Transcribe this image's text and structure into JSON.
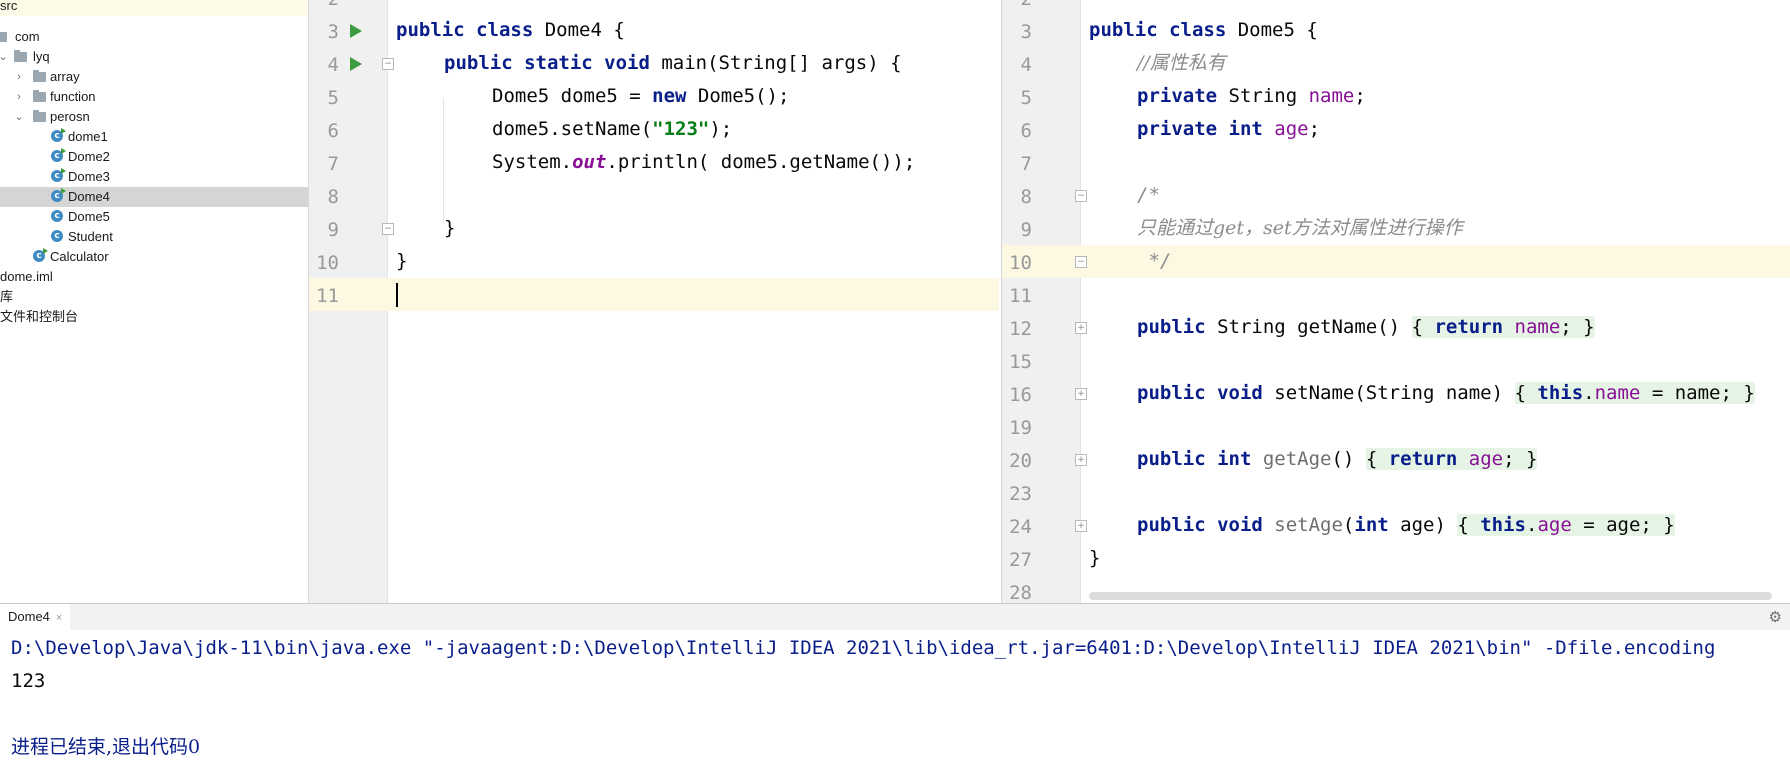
{
  "project_tree": {
    "items": [
      {
        "label": "src",
        "kind": "folder"
      },
      {
        "label": "com",
        "kind": "folder"
      },
      {
        "label": "lyq",
        "kind": "folder"
      },
      {
        "label": "array",
        "kind": "folder"
      },
      {
        "label": "function",
        "kind": "folder"
      },
      {
        "label": "perosn",
        "kind": "folder"
      },
      {
        "label": "dome1",
        "kind": "class-run"
      },
      {
        "label": "Dome2",
        "kind": "class-run"
      },
      {
        "label": "Dome3",
        "kind": "class-run"
      },
      {
        "label": "Dome4",
        "kind": "class-run",
        "selected": true
      },
      {
        "label": "Dome5",
        "kind": "class"
      },
      {
        "label": "Student",
        "kind": "class"
      },
      {
        "label": "Calculator",
        "kind": "class-run"
      },
      {
        "label": "dome.iml",
        "kind": "file"
      },
      {
        "label": "库",
        "kind": "library"
      },
      {
        "label": "文件和控制台",
        "kind": "scratch"
      }
    ]
  },
  "editor_left": {
    "file": "Dome4",
    "line_numbers": [
      "2",
      "3",
      "4",
      "5",
      "6",
      "7",
      "8",
      "9",
      "10",
      "11"
    ],
    "lines": {
      "l3_kw": "public class ",
      "l3_rest": "Dome4 {",
      "l4_kw": "public static void ",
      "l4_rest": "main(String[] args) {",
      "l5_a": "Dome5 dome5 = ",
      "l5_kw": "new ",
      "l5_b": "Dome5();",
      "l6_a": "dome5.setName(",
      "l6_str": "\"123\"",
      "l6_b": ");",
      "l7_a": "System.",
      "l7_field": "out",
      "l7_b": ".println( dome5.getName());",
      "l9": "}",
      "l10": "}"
    }
  },
  "editor_right": {
    "file": "Dome5",
    "line_numbers": [
      "2",
      "3",
      "4",
      "5",
      "6",
      "7",
      "8",
      "9",
      "10",
      "11",
      "12",
      "15",
      "16",
      "19",
      "20",
      "23",
      "24",
      "27",
      "28"
    ],
    "lines": {
      "l3_kw": "public class ",
      "l3_rest": "Dome5 {",
      "l4_comment": "//属性私有",
      "l5_kw": "private ",
      "l5_type": "String ",
      "l5_field": "name",
      "l5_end": ";",
      "l6_kw": "private int ",
      "l6_field": "age",
      "l6_end": ";",
      "l8_comment": "/*",
      "l9_comment": "只能通过get，set方法对属性进行操作",
      "l10_comment": " */",
      "l12_kw": "public ",
      "l12_a": "String getName() ",
      "l12_fold_kw": "return ",
      "l12_fold_field": "name",
      "l12_fold_end": "; ",
      "l16_kw": "public void ",
      "l16_a": "setName(String name) ",
      "l16_this": "this",
      "l16_dot": ".",
      "l16_field": "name",
      "l16_b": " = name; ",
      "l20_kw": "public int ",
      "l20_method": "getAge",
      "l20_a": "() ",
      "l20_ret": "return ",
      "l20_field": "age",
      "l20_end": "; ",
      "l24_kw": "public void ",
      "l24_method": "setAge",
      "l24_a": "(",
      "l24_int": "int ",
      "l24_b": "age) ",
      "l24_this": "this",
      "l24_dot": ".",
      "l24_field": "age",
      "l24_c": " = age; ",
      "l27": "}",
      "open_brace": "{ ",
      "close_brace": "}"
    }
  },
  "run_window": {
    "tab_label": "Dome4",
    "tab_close": "×",
    "settings_icon": "⚙",
    "console": {
      "command": "D:\\Develop\\Java\\jdk-11\\bin\\java.exe \"-javaagent:D:\\Develop\\IntelliJ IDEA 2021\\lib\\idea_rt.jar=6401:D:\\Develop\\IntelliJ IDEA 2021\\bin\" -Dfile.encoding",
      "output": "123",
      "exit_message": "进程已结束,退出代码0"
    }
  },
  "colors": {
    "keyword": "#0a1e8a",
    "string": "#067d17",
    "field": "#871094",
    "comment": "#8c8c8c",
    "run_green": "#3d9a3d",
    "selection": "#d5d5d5",
    "current_line": "#fdf8e2"
  }
}
